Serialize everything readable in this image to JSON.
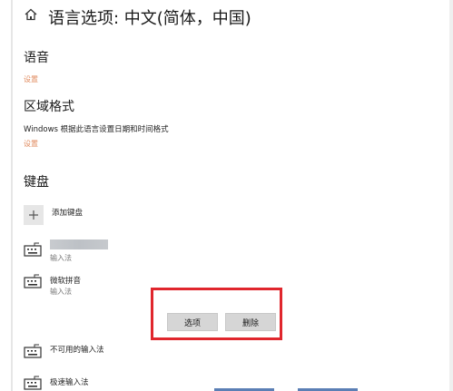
{
  "header": {
    "title": "语言选项: 中文(简体，中国)",
    "home_icon": "home-icon"
  },
  "speech": {
    "heading": "语音",
    "settings_link": "设置"
  },
  "region": {
    "heading": "区域格式",
    "description": "Windows 根据此语言设置日期和时间格式",
    "settings_link": "设置"
  },
  "keyboard": {
    "heading": "键盘",
    "add_label": "添加键盘",
    "items": [
      {
        "name": "",
        "type": "输入法",
        "icon": "keyboard-icon"
      },
      {
        "name": "微软拼音",
        "type": "输入法",
        "icon": "keyboard-icon"
      },
      {
        "name": "不可用的输入法",
        "type": "",
        "icon": "keyboard-icon"
      },
      {
        "name": "极速输入法",
        "type": "",
        "icon": "keyboard-icon"
      }
    ],
    "options_label": "选项",
    "remove_label": "删除"
  },
  "colors": {
    "highlight": "#e0262d",
    "link": "#e08a5e"
  }
}
